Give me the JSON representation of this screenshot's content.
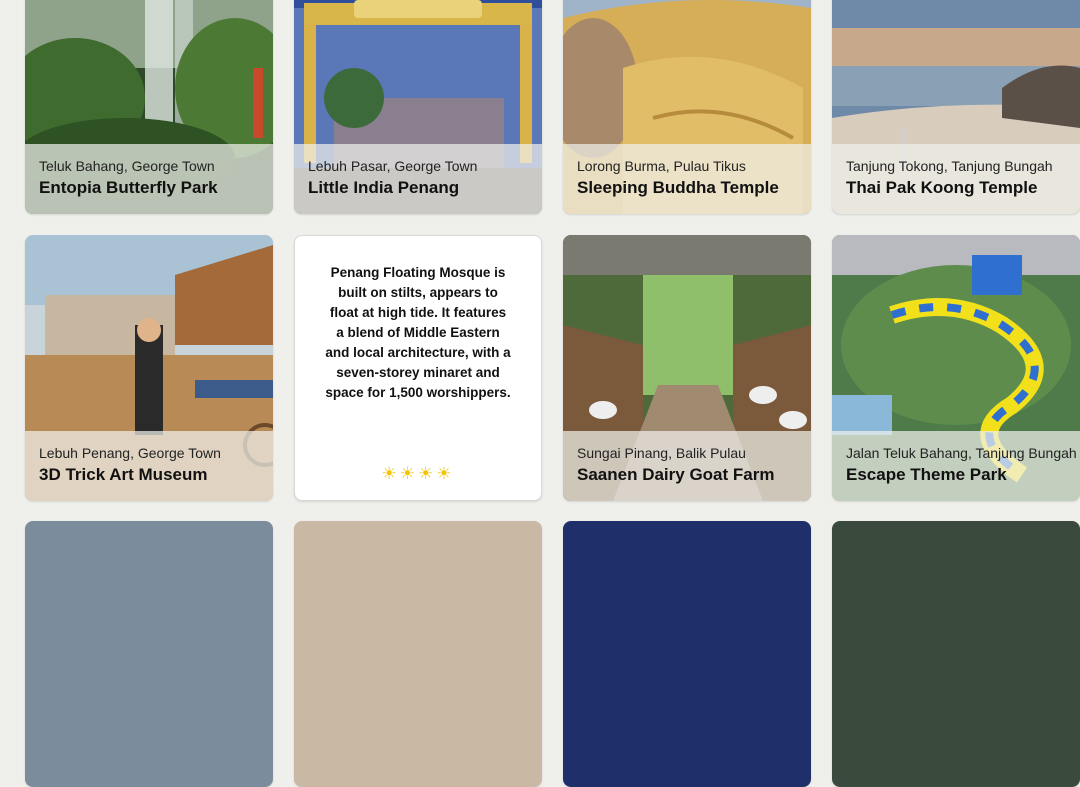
{
  "cards": [
    {
      "location": "Teluk Bahang, George Town",
      "name": "Entopia Butterfly Park"
    },
    {
      "location": "Lebuh Pasar, George Town",
      "name": "Little India Penang"
    },
    {
      "location": "Lorong Burma, Pulau Tikus",
      "name": "Sleeping Buddha Temple"
    },
    {
      "location": "Tanjung Tokong, Tanjung Bungah",
      "name": "Thai Pak Koong Temple"
    },
    {
      "location": "Lebuh Penang, George Town",
      "name": "3D Trick Art Museum"
    },
    {
      "location": "Sungai Pinang, Balik Pulau",
      "name": "Saanen Dairy Goat Farm"
    },
    {
      "location": "Jalan Teluk Bahang, Tanjung Bungah",
      "name": "Escape Theme Park"
    }
  ],
  "info_card": {
    "text": "Penang Floating Mosque is built on stilts, appears to float at high tide. It features a blend of Middle Eastern and local architecture, with a seven-storey minaret and space for 1,500 worshippers.",
    "icons": "☀☀☀☀"
  }
}
